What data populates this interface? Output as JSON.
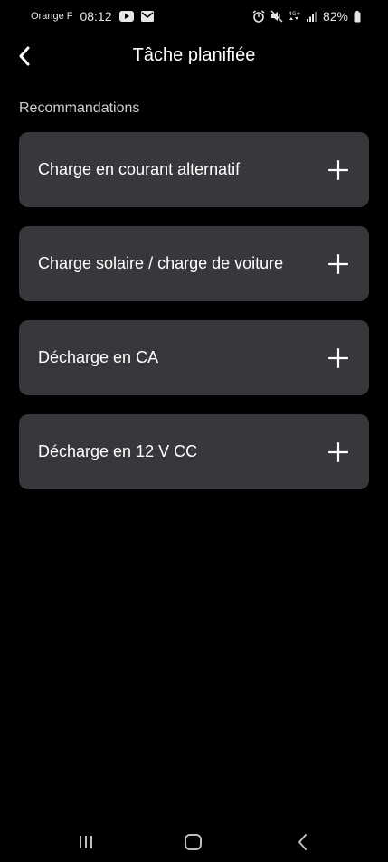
{
  "status_bar": {
    "carrier": "Orange F",
    "time": "08:12",
    "battery": "82%"
  },
  "header": {
    "title": "Tâche planifiée",
    "back_icon": "back-arrow-icon"
  },
  "recommendations": {
    "label": "Recommandations",
    "items": [
      {
        "label": "Charge en courant alternatif",
        "icon": "plus-icon"
      },
      {
        "label": "Charge solaire / charge de voiture",
        "icon": "plus-icon"
      },
      {
        "label": "Décharge en CA",
        "icon": "plus-icon"
      },
      {
        "label": "Décharge en 12 V CC",
        "icon": "plus-icon"
      }
    ]
  },
  "nav_bar": {
    "icons": [
      "recents-icon",
      "home-icon",
      "back-icon"
    ]
  },
  "colors": {
    "background": "#000000",
    "card": "#38383c",
    "text": "#ffffff",
    "muted_text": "#cfcfcf"
  }
}
